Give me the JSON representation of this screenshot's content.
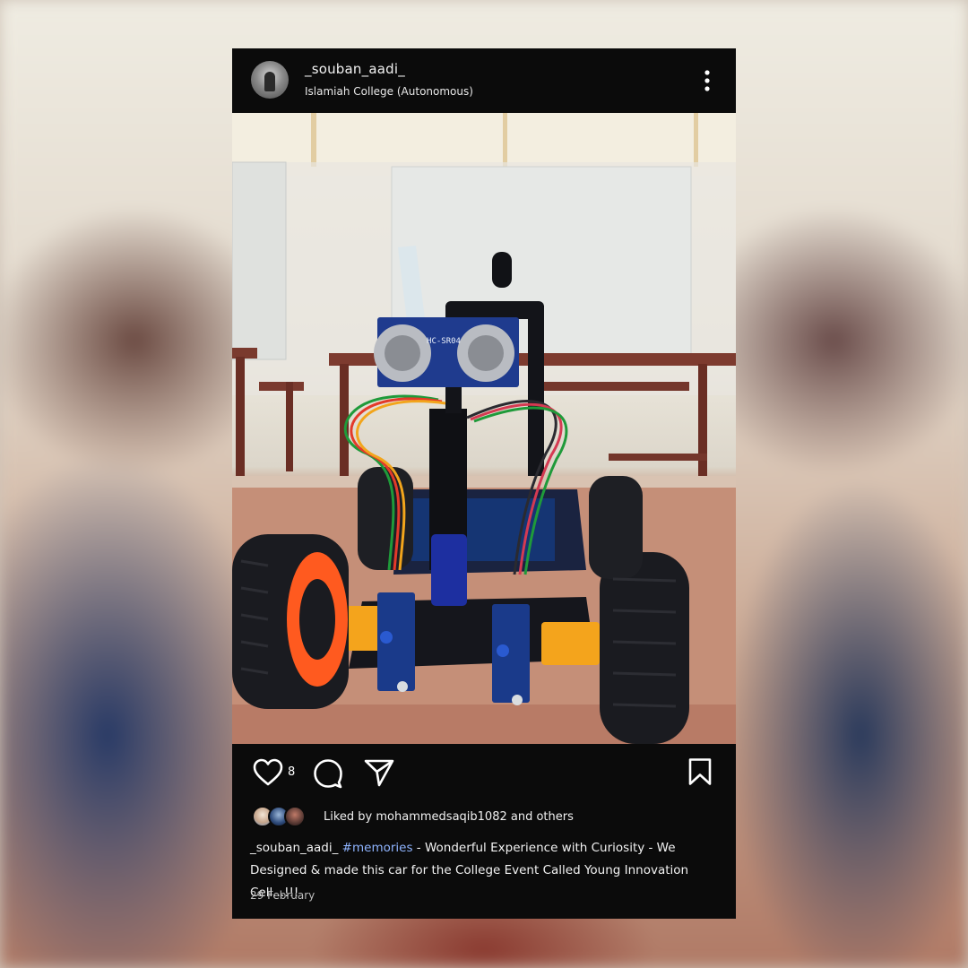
{
  "post": {
    "username": "_souban_aadi_",
    "location": "Islamiah College (Autonomous)",
    "like_count": "8",
    "liked_by_prefix": "Liked by ",
    "liked_by_user": "mohammedsaqib1082",
    "liked_by_suffix": " and others",
    "caption_user": "_souban_aadi_",
    "caption_hashtag": "#memories",
    "caption_text": " - Wonderful Experience with Curiosity - We Designed & made this car for the College Event Called Young Innovation Cell...!!!",
    "date": "29 February"
  },
  "sensor_label": "HC-SR04",
  "icons": {
    "more": "more-vertical-icon",
    "like": "heart-icon",
    "comment": "comment-icon",
    "share": "send-icon",
    "save": "bookmark-icon"
  },
  "colors": {
    "post_bg": "#0b0b0b",
    "hashtag": "#8fb4ff",
    "text": "#f2f2f2"
  }
}
